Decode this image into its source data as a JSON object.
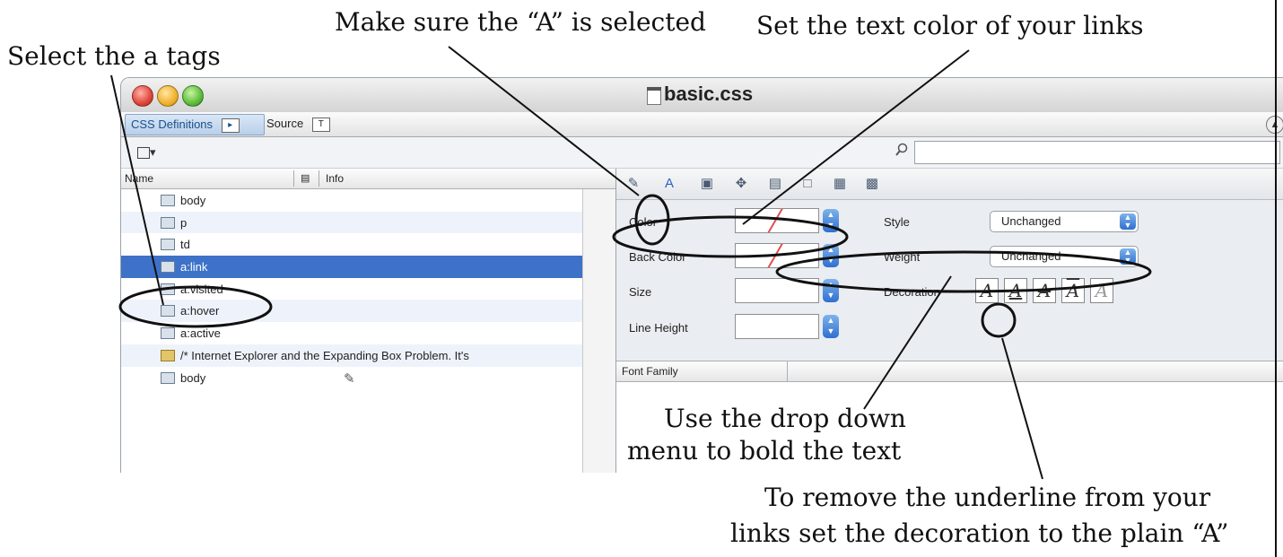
{
  "callouts": {
    "make_sure_a": "Make sure the “A” is selected",
    "set_text_color": "Set the text color of your links",
    "select_a_tags": "Select the a tags",
    "use_drop_down_1": "Use the drop down",
    "use_drop_down_2": "menu to bold the text",
    "remove_underline_1": "To remove the underline from your",
    "remove_underline_2": "links set the decoration to the plain “A”"
  },
  "window": {
    "title": "basic.css",
    "tabs": [
      {
        "label": "CSS Definitions",
        "glyph": "▸"
      },
      {
        "label": "Source",
        "glyph": "T"
      }
    ]
  },
  "rule_list": {
    "header_name": "Name",
    "header_info": "Info",
    "rows": [
      {
        "label": "body",
        "selected": false
      },
      {
        "label": "p",
        "selected": false
      },
      {
        "label": "td",
        "selected": false
      },
      {
        "label": "a:link",
        "selected": true
      },
      {
        "label": "a:visited",
        "selected": false
      },
      {
        "label": "a:hover",
        "selected": false
      },
      {
        "label": "a:active",
        "selected": false
      },
      {
        "label": "/* Internet Explorer and the Expanding Box Problem. It's",
        "selected": false,
        "comment": true
      },
      {
        "label": "body",
        "selected": false
      }
    ]
  },
  "text_panel": {
    "color_label": "Color",
    "back_color_label": "Back Color",
    "size_label": "Size",
    "line_height_label": "Line Height",
    "style_label": "Style",
    "style_value": "Unchanged",
    "weight_label": "Weight",
    "weight_value": "Unchanged",
    "decoration_label": "Decoration",
    "decoration_options": [
      "A",
      "A",
      "A",
      "A",
      "A"
    ],
    "font_family_label": "Font Family"
  },
  "colors": {
    "selection": "#3d72c8",
    "accent_blue": "#2f6fcf"
  }
}
